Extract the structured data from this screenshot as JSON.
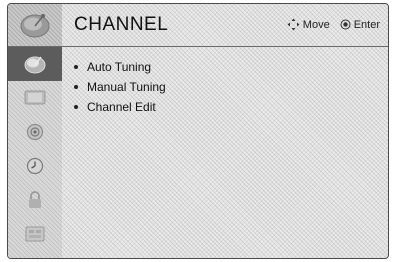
{
  "header": {
    "title": "CHANNEL",
    "icon": "satellite-dish-icon",
    "hints": [
      {
        "icon": "move-arrows-icon",
        "label": "Move"
      },
      {
        "icon": "enter-dot-icon",
        "label": "Enter"
      }
    ]
  },
  "sidebar": {
    "items": [
      {
        "name": "channel",
        "icon": "satellite-dish-icon",
        "active": true
      },
      {
        "name": "picture",
        "icon": "tv-screen-icon",
        "active": false
      },
      {
        "name": "audio",
        "icon": "speaker-icon",
        "active": false
      },
      {
        "name": "time",
        "icon": "clock-icon",
        "active": false
      },
      {
        "name": "lock",
        "icon": "lock-icon",
        "active": false
      },
      {
        "name": "option",
        "icon": "options-icon",
        "active": false
      }
    ]
  },
  "menu": {
    "items": [
      {
        "label": "Auto Tuning"
      },
      {
        "label": "Manual Tuning"
      },
      {
        "label": "Channel Edit"
      }
    ]
  },
  "colors": {
    "active_tab": "#5c5c5c",
    "border": "#4a4a4a"
  }
}
